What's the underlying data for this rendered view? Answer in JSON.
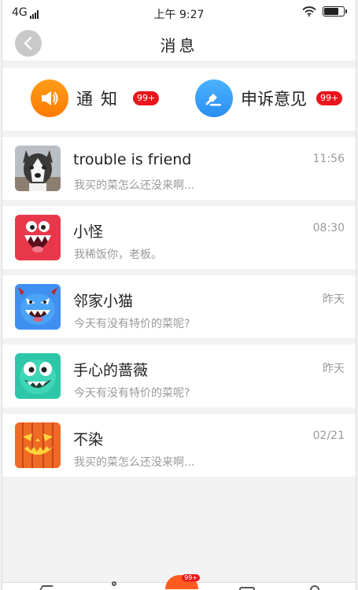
{
  "status_bar": {
    "network": "4G",
    "time": "上午 9:27",
    "battery_level": 0.75
  },
  "header": {
    "title": "消息",
    "back_icon": "chevron-left-icon"
  },
  "quick_actions": [
    {
      "label": "通知",
      "icon": "speaker-icon",
      "badge": "99+",
      "color": "#ff8a00"
    },
    {
      "label": "申诉意见",
      "icon": "hammer-icon",
      "badge": "99+",
      "color": "#2f95f2"
    }
  ],
  "messages": [
    {
      "name": "trouble is friend",
      "time": "11:56",
      "preview": "我买的菜怎么还没来啊...",
      "avatar": "husky-avatar"
    },
    {
      "name": "小怪",
      "time": "08:30",
      "preview": "我稀饭你，老板。",
      "avatar": "red-monster-avatar"
    },
    {
      "name": "邻家小猫",
      "time": "昨天",
      "preview": "今天有没有特价的菜呢?",
      "avatar": "blue-monster-avatar"
    },
    {
      "name": "手心的蔷薇",
      "time": "昨天",
      "preview": "今天有没有特价的菜呢?",
      "avatar": "green-monster-avatar"
    },
    {
      "name": "不染",
      "time": "02/21",
      "preview": "我买的菜怎么还没来啊...",
      "avatar": "pumpkin-avatar"
    }
  ],
  "tab_bar": {
    "center_badge": "99+"
  },
  "colors": {
    "badge": "#e8161b",
    "accent_orange": "#ff8a00",
    "accent_blue": "#2f95f2",
    "background": "#f2f2f2"
  }
}
